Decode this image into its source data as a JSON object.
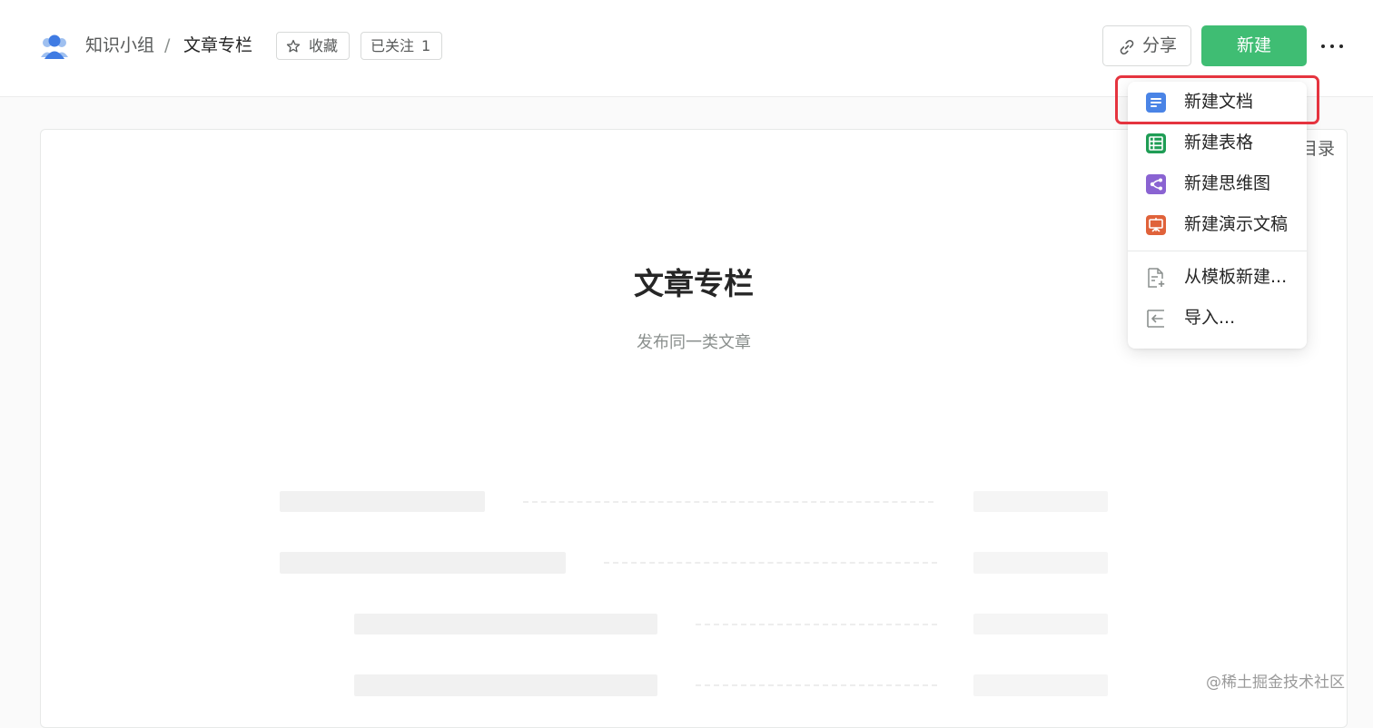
{
  "header": {
    "group_name": "知识小组",
    "separator": "/",
    "book_name": "文章专栏",
    "star_label": "收藏",
    "follow_label": "已关注",
    "follow_count": "1",
    "share_label": "分享",
    "new_label": "新建"
  },
  "book": {
    "toc_label": "目录",
    "title": "文章专栏",
    "description": "发布同一类文章"
  },
  "new_menu": {
    "items": [
      {
        "label": "新建文档",
        "icon": "doc-icon",
        "color": "#4a84e6"
      },
      {
        "label": "新建表格",
        "icon": "sheet-icon",
        "color": "#1f9d55"
      },
      {
        "label": "新建思维图",
        "icon": "mindmap-icon",
        "color": "#8a63d2"
      },
      {
        "label": "新建演示文稿",
        "icon": "slides-icon",
        "color": "#e0623a"
      },
      {
        "label": "从模板新建...",
        "icon": "template-icon",
        "color": "#8a8f8d"
      },
      {
        "label": "导入...",
        "icon": "import-icon",
        "color": "#8a8f8d"
      }
    ],
    "highlighted_item": "新建文档"
  },
  "colors": {
    "accent_green": "#3fbd73",
    "highlight_red": "#e5343f"
  },
  "watermark": "@稀土掘金技术社区"
}
